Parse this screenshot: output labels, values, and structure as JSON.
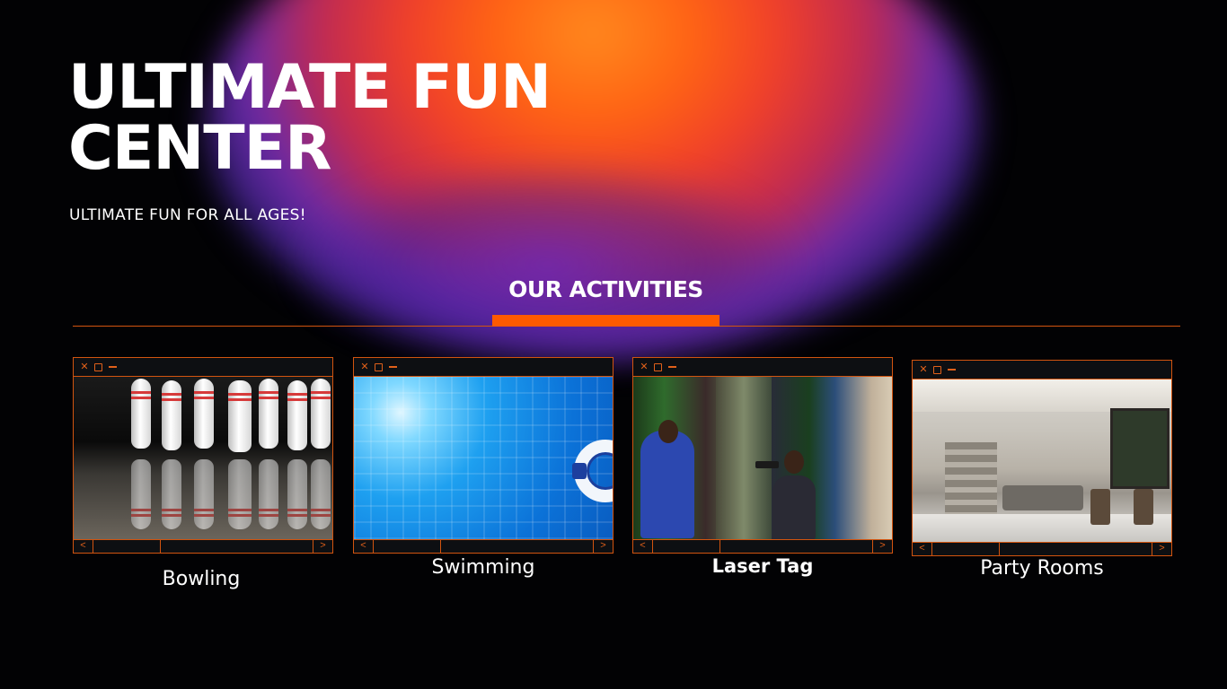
{
  "hero": {
    "title_line1": "ULTIMATE FUN",
    "title_line2": "CENTER",
    "subtitle": "ULTIMATE FUN FOR ALL AGES!"
  },
  "section": {
    "title": "OUR ACTIVITIES"
  },
  "window_controls": {
    "close_glyph": "✕",
    "prev_glyph": "<",
    "next_glyph": ">"
  },
  "activities": [
    {
      "label": "Bowling",
      "image": "bowling-pins-photo"
    },
    {
      "label": "Swimming",
      "image": "swimming-pool-photo"
    },
    {
      "label": "Laser Tag",
      "image": "laser-tag-photo"
    },
    {
      "label": "Party Rooms",
      "image": "party-room-photo"
    }
  ],
  "colors": {
    "accent": "#ff5a00",
    "border": "#d2540f",
    "background": "#020204"
  }
}
